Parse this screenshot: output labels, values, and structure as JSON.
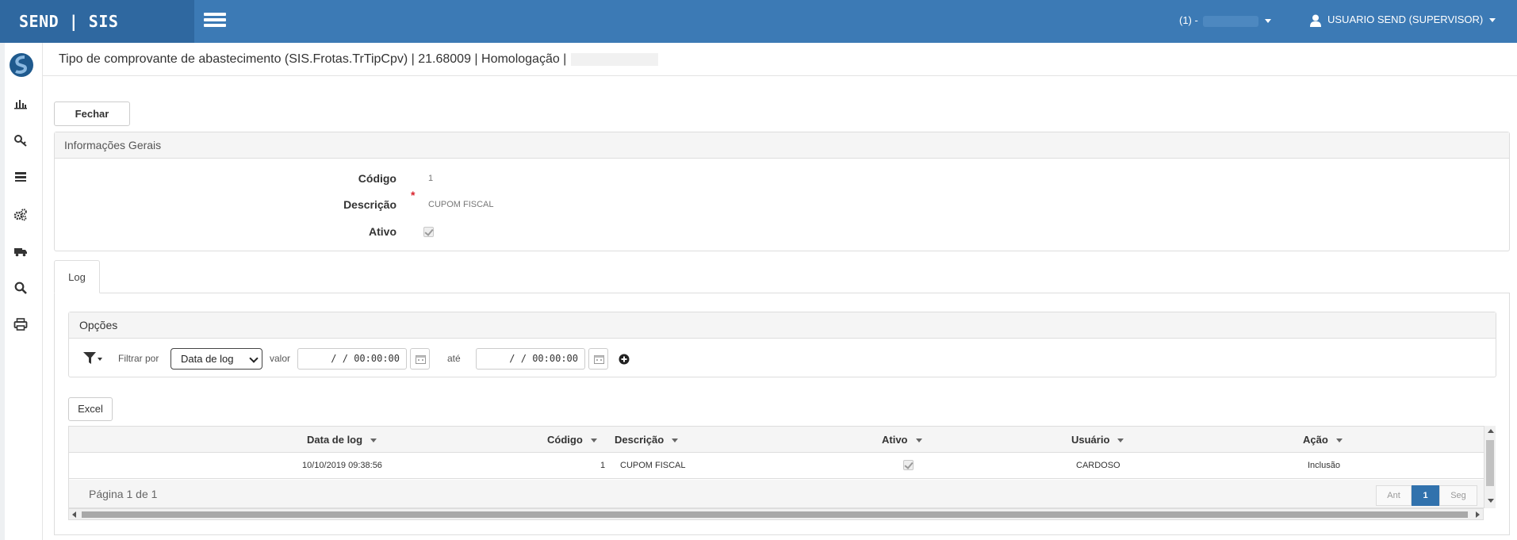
{
  "app": {
    "brand": "SEND | SIS",
    "company_prefix": "(1) -",
    "user": "USUARIO SEND (SUPERVISOR)"
  },
  "page": {
    "title": "Tipo de comprovante de abastecimento (SIS.Frotas.TrTipCpv) | 21.68009 | Homologação |"
  },
  "sidebar": {
    "icons": [
      "bar-chart-icon",
      "key-icon",
      "list-icon",
      "gears-icon",
      "truck-icon",
      "search-icon",
      "print-icon"
    ]
  },
  "toolbar": {
    "close_label": "Fechar"
  },
  "general": {
    "heading": "Informações Gerais",
    "code_label": "Código",
    "code_value": "1",
    "description_label": "Descrição",
    "required_mark": "*",
    "description_value": "CUPOM FISCAL",
    "active_label": "Ativo",
    "active_checked": true
  },
  "tabs": [
    {
      "label": "Log",
      "active": true
    }
  ],
  "options": {
    "heading": "Opções",
    "filter_by_label": "Filtrar por",
    "filter_selected": "Data de log",
    "value_label": "valor",
    "from_value": "/ /    00:00:00",
    "to_label": "até",
    "to_value": "/ /    00:00:00"
  },
  "excel_label": "Excel",
  "grid": {
    "columns": [
      "Data de log",
      "Código",
      "Descrição",
      "Ativo",
      "Usuário",
      "Ação"
    ],
    "rows": [
      {
        "date": "10/10/2019 09:38:56",
        "code": "1",
        "description": "CUPOM FISCAL",
        "active": true,
        "user": "CARDOSO",
        "action": "Inclusão"
      }
    ],
    "page_info": "Página 1 de 1",
    "prev_label": "Ant",
    "current_page": "1",
    "next_label": "Seg"
  },
  "colors": {
    "navbar": "#3c7ab5",
    "brand_bg": "#2f68a0",
    "required": "#d9232d",
    "pager_active": "#3172ad"
  }
}
